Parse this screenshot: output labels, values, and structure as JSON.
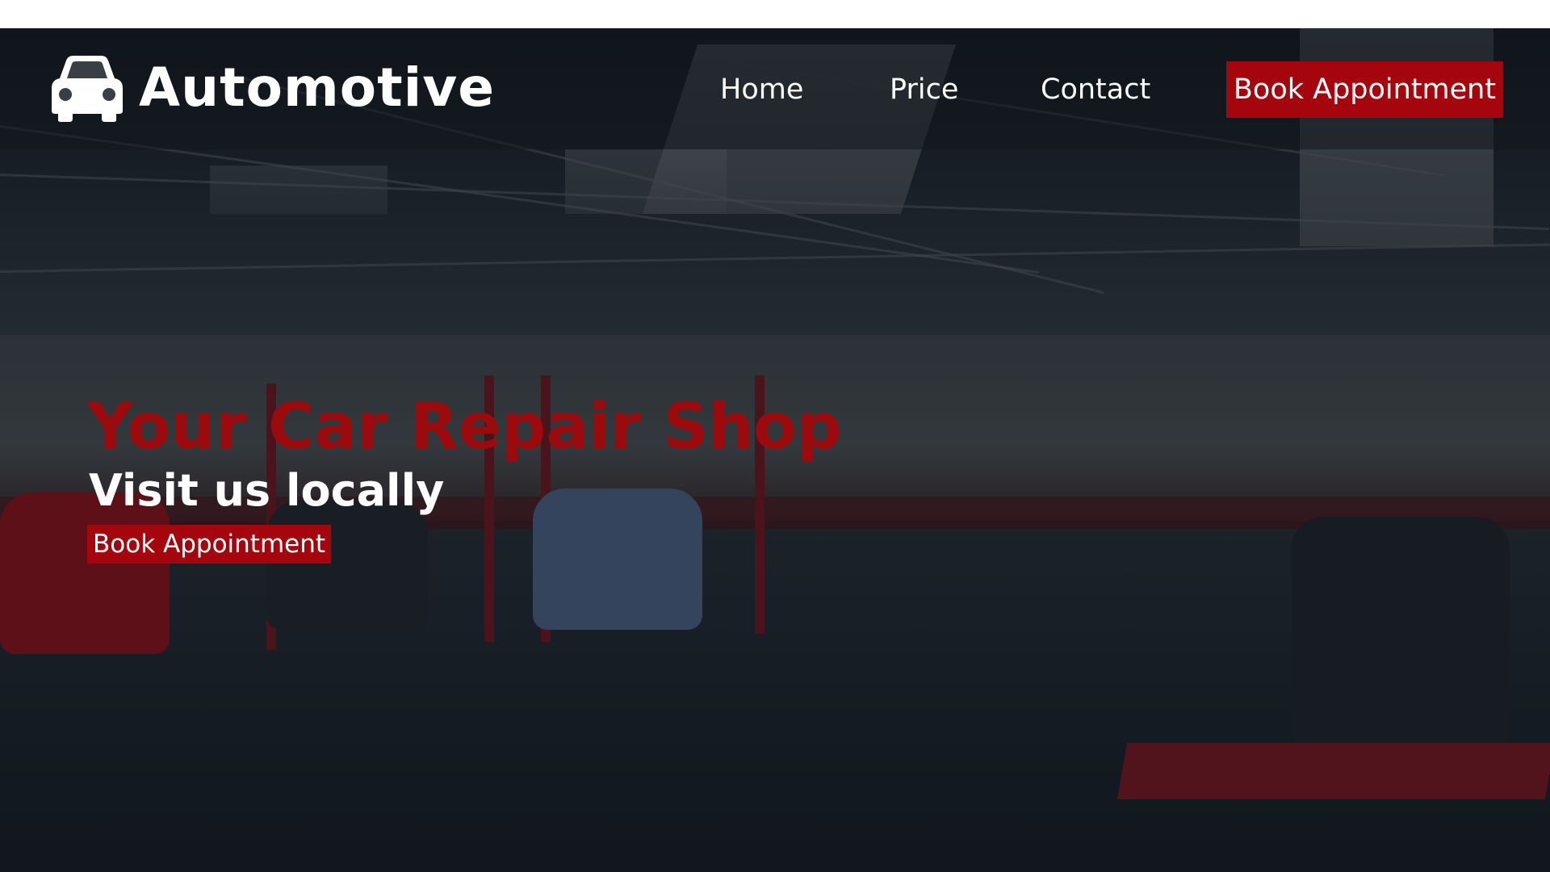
{
  "header": {
    "logo_icon": "car-icon",
    "brand": "Automotive",
    "nav": [
      {
        "label": "Home"
      },
      {
        "label": "Price"
      },
      {
        "label": "Contact"
      }
    ],
    "cta_label": "Book Appointment"
  },
  "hero": {
    "title": "Your Car Repair Shop",
    "subtitle": "Visit us locally",
    "cta_label": "Book Appointment",
    "background": "car-repair-garage-photo"
  },
  "colors": {
    "accent": "#a5060d",
    "title_red": "#9b0a0d",
    "text": "#ffffff"
  }
}
